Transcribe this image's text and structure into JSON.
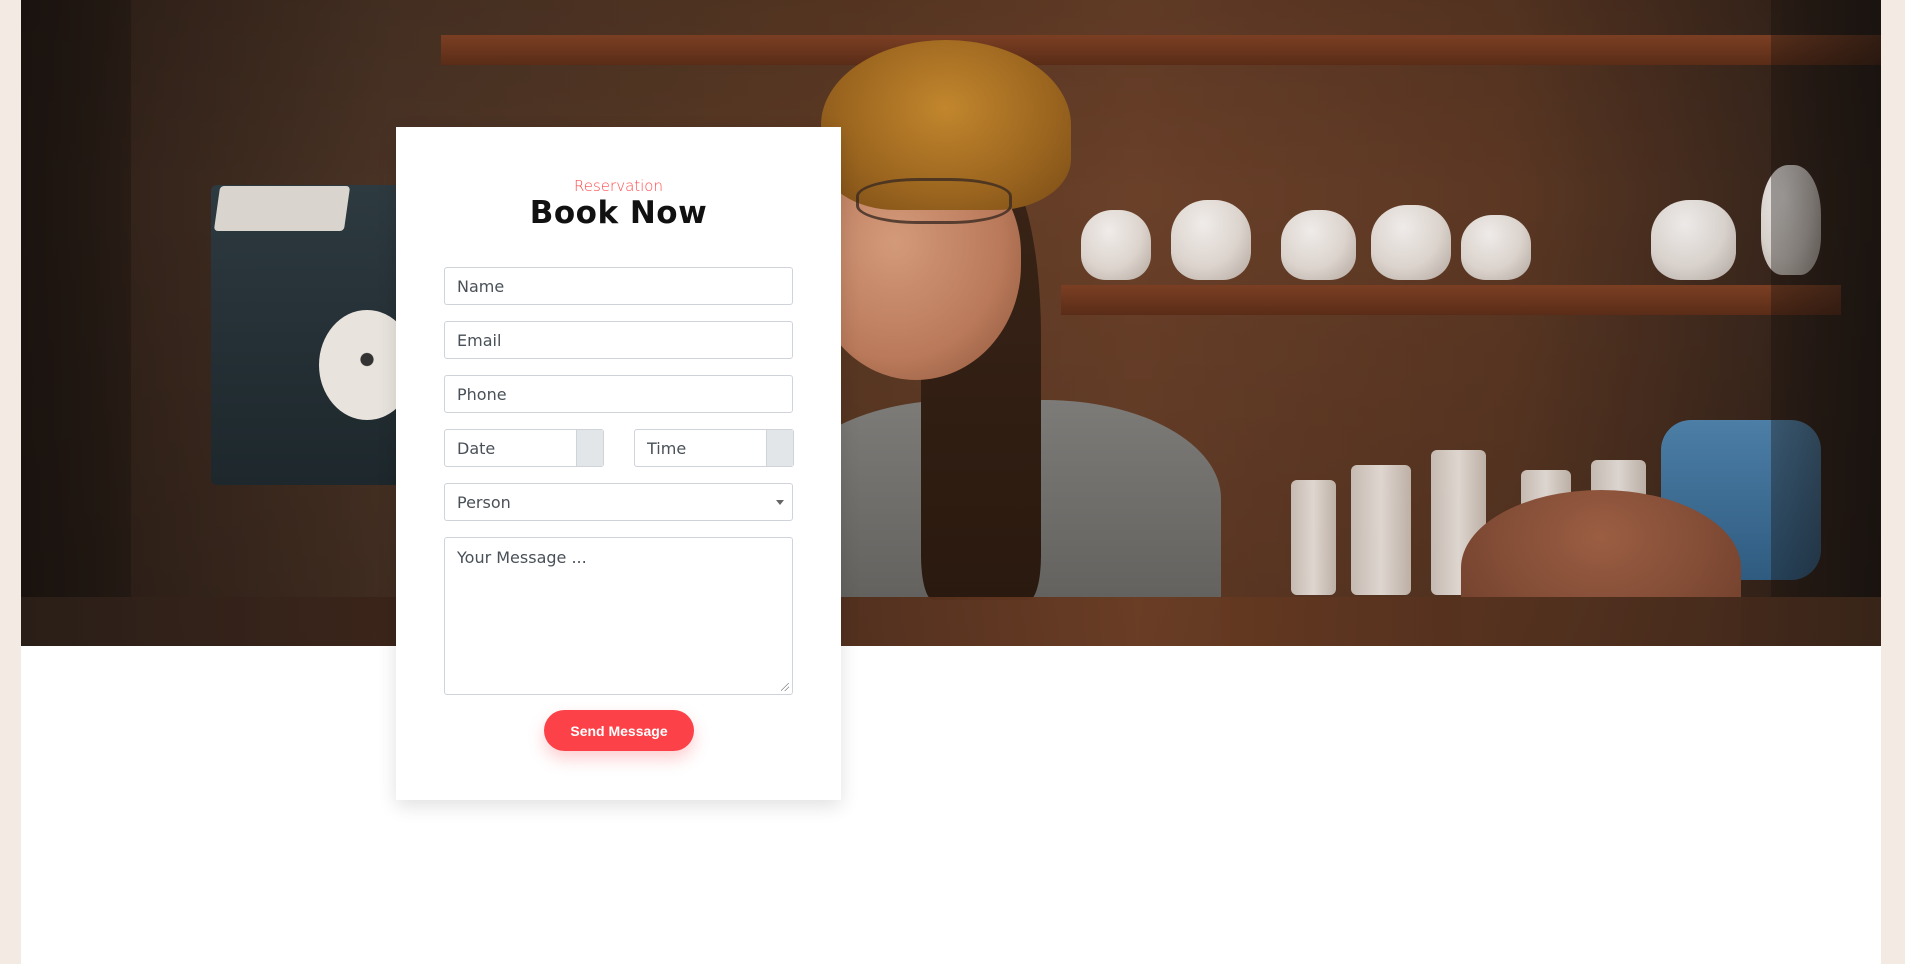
{
  "reservation": {
    "eyebrow": "Reservation",
    "title": "Book Now",
    "fields": {
      "name_placeholder": "Name",
      "email_placeholder": "Email",
      "phone_placeholder": "Phone",
      "date_placeholder": "Date",
      "time_placeholder": "Time",
      "person_selected": "Person",
      "message_placeholder": "Your Message ..."
    },
    "submit_label": "Send Message"
  },
  "colors": {
    "accent": "#fd4148",
    "eyebrow": "#ff4a4a",
    "page_bg": "#f3ebe3"
  }
}
